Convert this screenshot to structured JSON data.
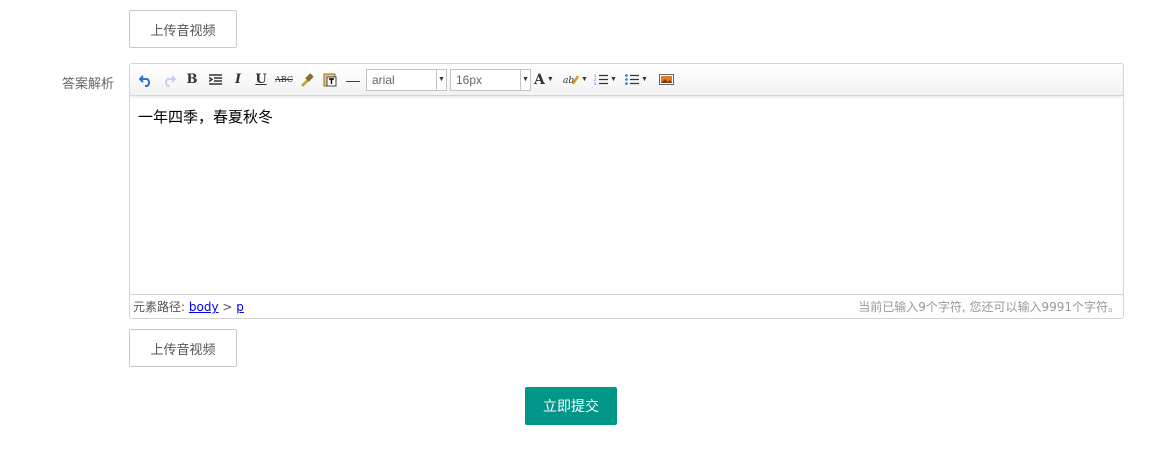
{
  "upload_top": {
    "label": "上传音视频"
  },
  "field": {
    "label": "答案解析"
  },
  "editor": {
    "toolbar": {
      "bold": "B",
      "italic": "I",
      "underline": "U",
      "strike": "ABC",
      "hr": "—",
      "font_family": "arial",
      "font_size": "16px",
      "font_color": "A"
    },
    "content": "一年四季，春夏秋冬",
    "statusbar": {
      "path_label": "元素路径:",
      "path_body": "body",
      "path_sep": ">",
      "path_p": "p",
      "wordcount": "当前已输入9个字符, 您还可以输入9991个字符。"
    }
  },
  "upload_bottom": {
    "label": "上传音视频"
  },
  "submit": {
    "label": "立即提交"
  },
  "colors": {
    "accent": "#009688"
  }
}
